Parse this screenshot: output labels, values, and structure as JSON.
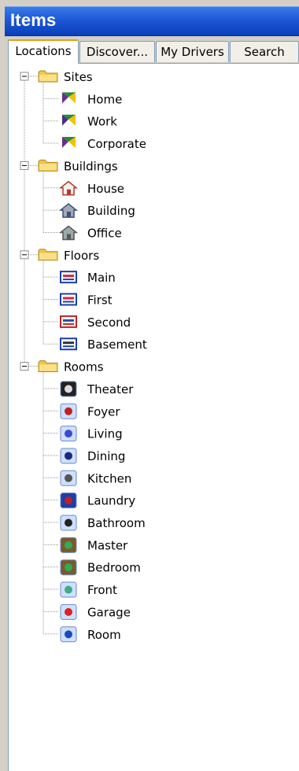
{
  "window": {
    "title": "Items"
  },
  "tabs": [
    {
      "label": "Locations",
      "active": true
    },
    {
      "label": "Discover...",
      "active": false
    },
    {
      "label": "My Drivers",
      "active": false
    },
    {
      "label": "Search",
      "active": false
    }
  ],
  "tree": {
    "groups": [
      {
        "label": "Sites",
        "expanded": true,
        "icon": "folder-icon",
        "items": [
          {
            "label": "Home",
            "icon": "site-home-icon"
          },
          {
            "label": "Work",
            "icon": "site-work-icon"
          },
          {
            "label": "Corporate",
            "icon": "site-corporate-icon"
          }
        ]
      },
      {
        "label": "Buildings",
        "expanded": true,
        "icon": "folder-icon",
        "items": [
          {
            "label": "House",
            "icon": "house-icon"
          },
          {
            "label": "Building",
            "icon": "building-icon"
          },
          {
            "label": "Office",
            "icon": "office-icon"
          }
        ]
      },
      {
        "label": "Floors",
        "expanded": true,
        "icon": "folder-icon",
        "items": [
          {
            "label": "Main",
            "icon": "floor-main-icon"
          },
          {
            "label": "First",
            "icon": "floor-first-icon"
          },
          {
            "label": "Second",
            "icon": "floor-second-icon"
          },
          {
            "label": "Basement",
            "icon": "floor-basement-icon"
          }
        ]
      },
      {
        "label": "Rooms",
        "expanded": true,
        "icon": "folder-icon",
        "items": [
          {
            "label": "Theater",
            "icon": "theater-icon"
          },
          {
            "label": "Foyer",
            "icon": "foyer-icon"
          },
          {
            "label": "Living",
            "icon": "living-icon"
          },
          {
            "label": "Dining",
            "icon": "dining-icon"
          },
          {
            "label": "Kitchen",
            "icon": "kitchen-icon"
          },
          {
            "label": "Laundry",
            "icon": "laundry-icon"
          },
          {
            "label": "Bathroom",
            "icon": "bathroom-icon"
          },
          {
            "label": "Master",
            "icon": "master-bed-icon"
          },
          {
            "label": "Bedroom",
            "icon": "bedroom-icon"
          },
          {
            "label": "Front",
            "icon": "front-icon"
          },
          {
            "label": "Garage",
            "icon": "garage-icon"
          },
          {
            "label": "Room",
            "icon": "room-icon"
          }
        ]
      }
    ]
  }
}
